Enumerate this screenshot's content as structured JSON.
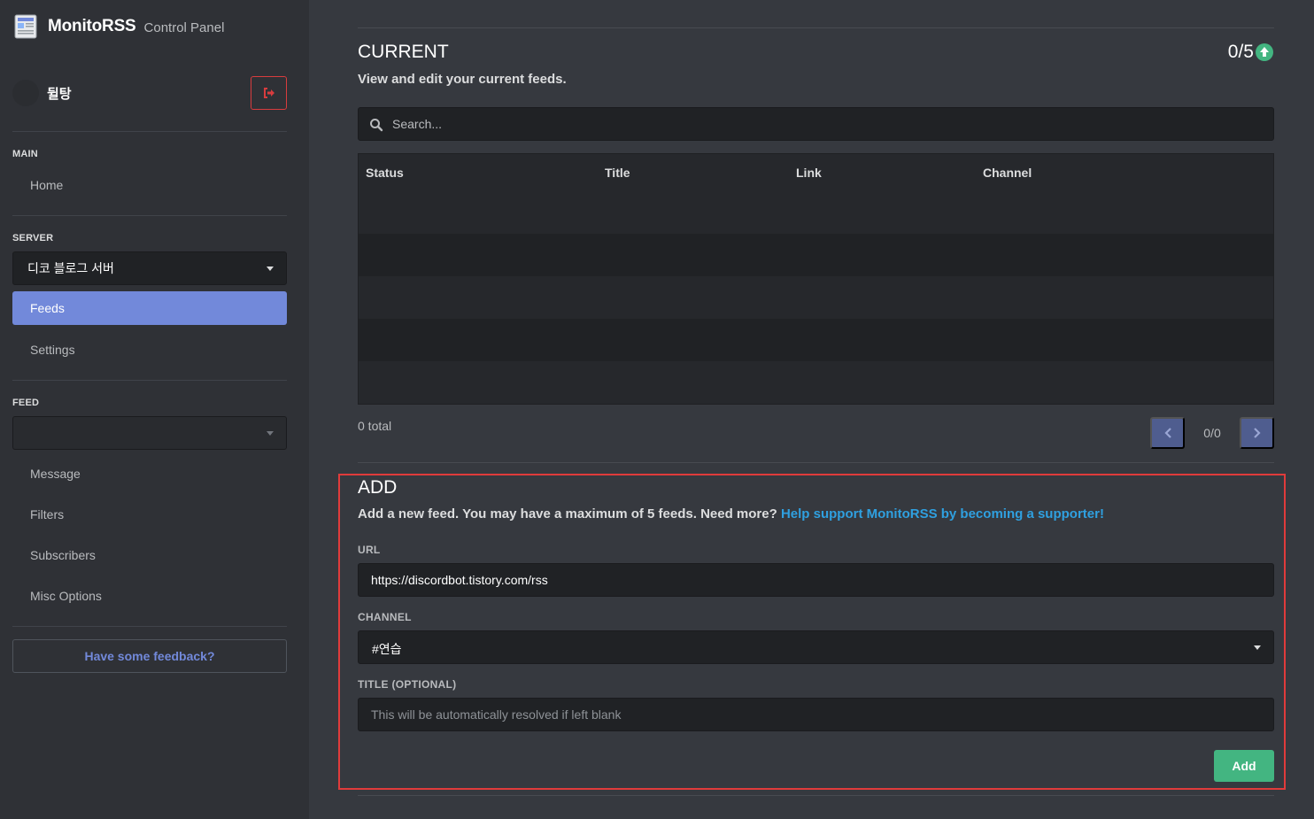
{
  "app": {
    "name": "MonitoRSS",
    "subtitle": "Control Panel"
  },
  "user": {
    "name": "뒬탕"
  },
  "sidebar": {
    "main_label": "MAIN",
    "home": "Home",
    "server_label": "SERVER",
    "server_selected": "디코 블로그 서버",
    "feeds": "Feeds",
    "settings": "Settings",
    "feed_label": "FEED",
    "feed_selected": "",
    "message": "Message",
    "filters": "Filters",
    "subscribers": "Subscribers",
    "misc_options": "Misc Options",
    "feedback": "Have some feedback?"
  },
  "current": {
    "title": "CURRENT",
    "count": "0/5",
    "description": "View and edit your current feeds.",
    "search_placeholder": "Search...",
    "columns": [
      "Status",
      "Title",
      "Link",
      "Channel"
    ],
    "rows": [],
    "total": "0 total",
    "page": "0/0"
  },
  "add": {
    "title": "ADD",
    "description": "Add a new feed. You may have a maximum of 5 feeds. Need more?",
    "support_link": "Help support MonitoRSS by becoming a supporter!",
    "url_label": "URL",
    "url_value": "https://discordbot.tistory.com/rss",
    "channel_label": "CHANNEL",
    "channel_value": "#연습",
    "title_label": "TITLE (OPTIONAL)",
    "title_placeholder": "This will be automatically resolved if left blank",
    "add_button": "Add"
  },
  "colors": {
    "accent": "#7289da",
    "success": "#43b581",
    "danger": "#d83c3e",
    "link": "#2fa0e0",
    "highlight": "#e03b3b"
  }
}
